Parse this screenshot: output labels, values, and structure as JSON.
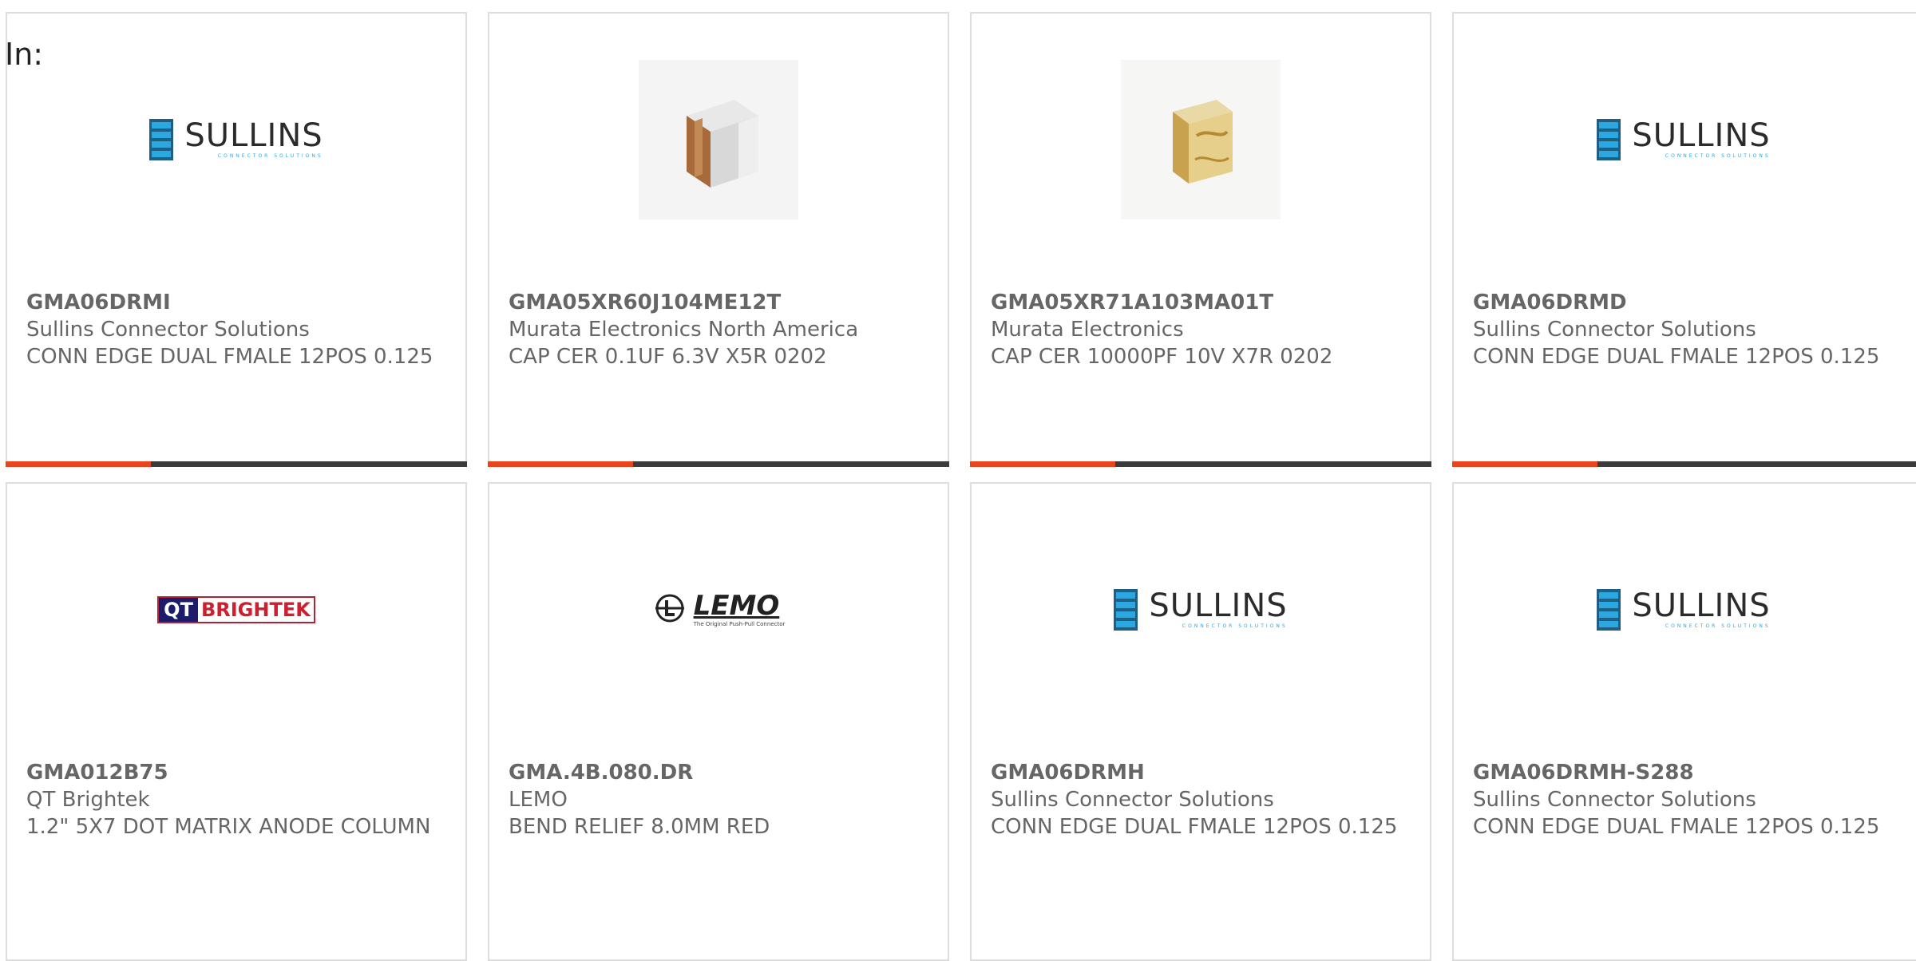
{
  "header": {
    "label": "In:"
  },
  "colors": {
    "accent": "#e8451e",
    "bar": "#3b3b3b",
    "sullins_blue": "#2ba8e0"
  },
  "cards": [
    {
      "part": "GMA06DRMI",
      "maker": "Sullins Connector Solutions",
      "desc": "CONN EDGE DUAL FMALE 12POS 0.125",
      "image": "sullins-logo"
    },
    {
      "part": "GMA05XR60J104ME12T",
      "maker": "Murata Electronics North America",
      "desc": "CAP CER 0.1UF 6.3V X5R 0202",
      "image": "capacitor-photo"
    },
    {
      "part": "GMA05XR71A103MA01T",
      "maker": "Murata Electronics",
      "desc": "CAP CER 10000PF 10V X7R 0202",
      "image": "capacitor-gold-photo"
    },
    {
      "part": "GMA06DRMD",
      "maker": "Sullins Connector Solutions",
      "desc": "CONN EDGE DUAL FMALE 12POS 0.125",
      "image": "sullins-logo"
    },
    {
      "part": "GMA012B75",
      "maker": "QT Brightek",
      "desc": "1.2\" 5X7 DOT MATRIX ANODE COLUMN",
      "image": "qt-brightek-logo"
    },
    {
      "part": "GMA.4B.080.DR",
      "maker": "LEMO",
      "desc": "BEND RELIEF 8.0MM RED",
      "image": "lemo-logo"
    },
    {
      "part": "GMA06DRMH",
      "maker": "Sullins Connector Solutions",
      "desc": "CONN EDGE DUAL FMALE 12POS 0.125",
      "image": "sullins-logo"
    },
    {
      "part": "GMA06DRMH-S288",
      "maker": "Sullins Connector Solutions",
      "desc": "CONN EDGE DUAL FMALE 12POS 0.125",
      "image": "sullins-logo"
    }
  ],
  "logos": {
    "sullins": {
      "word": "SULLINS",
      "tagline": "CONNECTOR SOLUTIONS"
    },
    "qt": {
      "left": "QT",
      "right": "BRIGHTEK"
    },
    "lemo": {
      "word": "LEMO",
      "tagline": "The Original Push-Pull Connector"
    }
  }
}
